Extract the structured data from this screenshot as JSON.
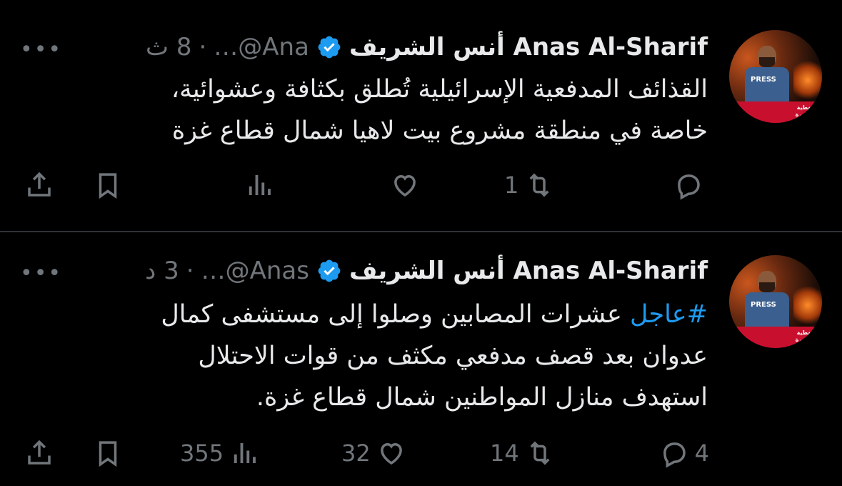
{
  "tweets": [
    {
      "author_name": "أنس الشريف Anas Al-Sharif",
      "handle": "…@Ana",
      "separator": "·",
      "time": "8 ث",
      "text_lines": [
        "القذائف المدفعية الإسرائيلية تُطلق بكثافة وعشوائية،",
        "خاصة في منطقة مشروع بيت لاهيا شمال قطاع غزة"
      ],
      "replies": "",
      "reposts": "1",
      "likes": "",
      "views": ""
    },
    {
      "author_name": "أنس الشريف Anas Al-Sharif",
      "handle": "…@Anas",
      "separator": "·",
      "time": "3 د",
      "hashtag": "#عاجل",
      "text_first_rest": " عشرات المصابين وصلوا إلى مستشفى كمال",
      "text_lines": [
        "عدوان بعد قصف مدفعي مكثف من قوات الاحتلال",
        "استهدف منازل المواطنين شمال قطاع غزة."
      ],
      "replies": "4",
      "reposts": "14",
      "likes": "32",
      "views": "355"
    }
  ],
  "avatar": {
    "press_label": "PRESS",
    "banner_text": "التغطية مستمرة قوات الاحتلال"
  },
  "colors": {
    "background": "#000000",
    "text": "#e7e9ea",
    "secondary": "#71767b",
    "accent": "#1d9bf0",
    "divider": "#2f3336"
  }
}
